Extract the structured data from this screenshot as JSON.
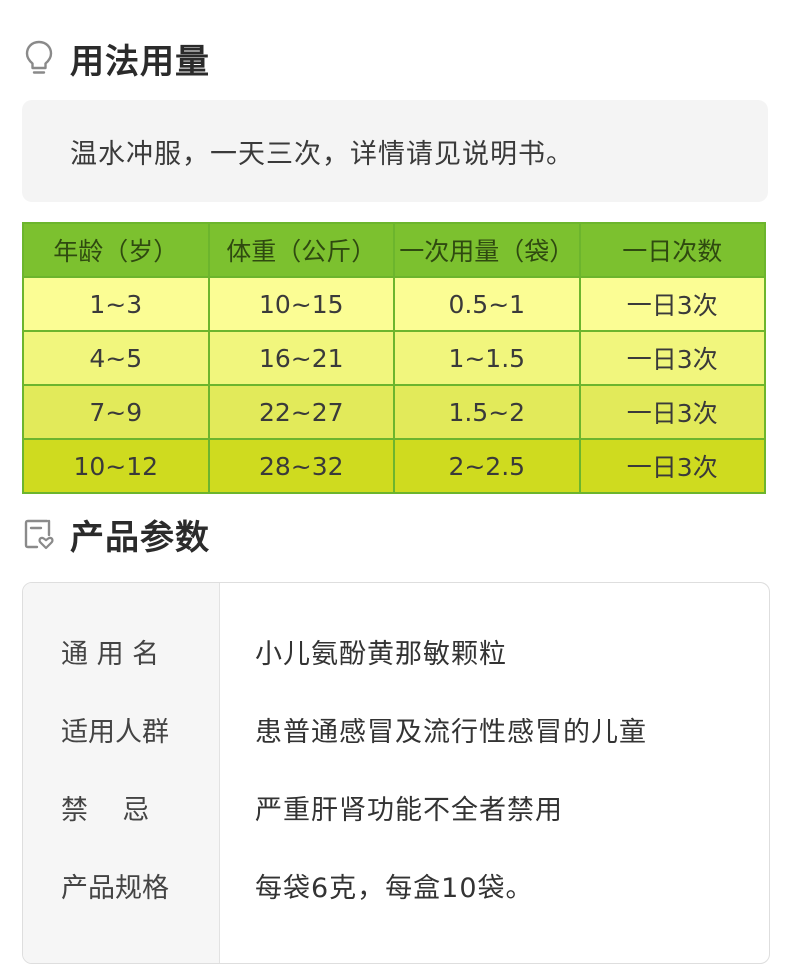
{
  "usage": {
    "icon": "lightbulb-icon",
    "title": "用法用量",
    "text": "温水冲服，一天三次，详情请见说明书。"
  },
  "dosage_table": {
    "headers": [
      "年龄（岁）",
      "体重（公斤）",
      "一次用量（袋）",
      "一日次数"
    ],
    "rows": [
      [
        "1~3",
        "10~15",
        "0.5~1",
        "一日3次"
      ],
      [
        "4~5",
        "16~21",
        "1~1.5",
        "一日3次"
      ],
      [
        "7~9",
        "22~27",
        "1.5~2",
        "一日3次"
      ],
      [
        "10~12",
        "28~32",
        "2~2.5",
        "一日3次"
      ]
    ]
  },
  "params": {
    "icon": "document-heart-icon",
    "title": "产品参数",
    "rows": [
      {
        "label": "通 用 名",
        "value": "小儿氨酚黄那敏颗粒"
      },
      {
        "label": "适用人群",
        "value": "患普通感冒及流行性感冒的儿童"
      },
      {
        "label": "禁    忌",
        "value": "严重肝肾功能不全者禁用"
      },
      {
        "label": "产品规格",
        "value": "每袋6克，每盒10袋。"
      }
    ]
  },
  "colors": {
    "table_header": "#7cc12f",
    "table_border": "#6cb52d",
    "row_shades": [
      "#fbfd94",
      "#f1f67d",
      "#e2ea5a",
      "#cfdb1f"
    ]
  }
}
